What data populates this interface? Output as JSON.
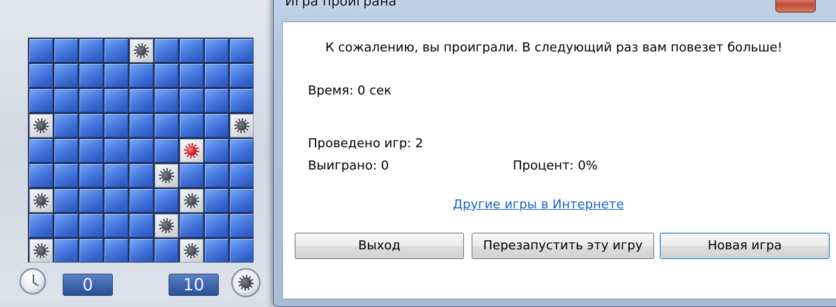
{
  "board": {
    "rows": 9,
    "cols": 9,
    "mines": [
      [
        0,
        4
      ],
      [
        3,
        0
      ],
      [
        3,
        8
      ],
      [
        5,
        5
      ],
      [
        6,
        0
      ],
      [
        6,
        6
      ],
      [
        7,
        5
      ],
      [
        8,
        0
      ],
      [
        8,
        6
      ]
    ],
    "exploded": [
      4,
      6
    ]
  },
  "status_bar": {
    "time": "0",
    "mines_left": "10"
  },
  "dialog": {
    "title": "Игра проиграна",
    "message": "К сожалению, вы проиграли. В следующий раз вам повезет больше!",
    "time_stat": "Время: 0 сек",
    "games_played": "Проведено игр: 2",
    "games_won": "Выиграно: 0",
    "win_percent": "Процент: 0%",
    "online_link": "Другие игры в Интернете",
    "buttons": {
      "exit": "Выход",
      "restart": "Перезапустить эту игру",
      "new_game": "Новая игра"
    }
  },
  "colors": {
    "tile": "#4d7fe3",
    "link": "#1a62c9",
    "close_button": "#c04b33"
  }
}
